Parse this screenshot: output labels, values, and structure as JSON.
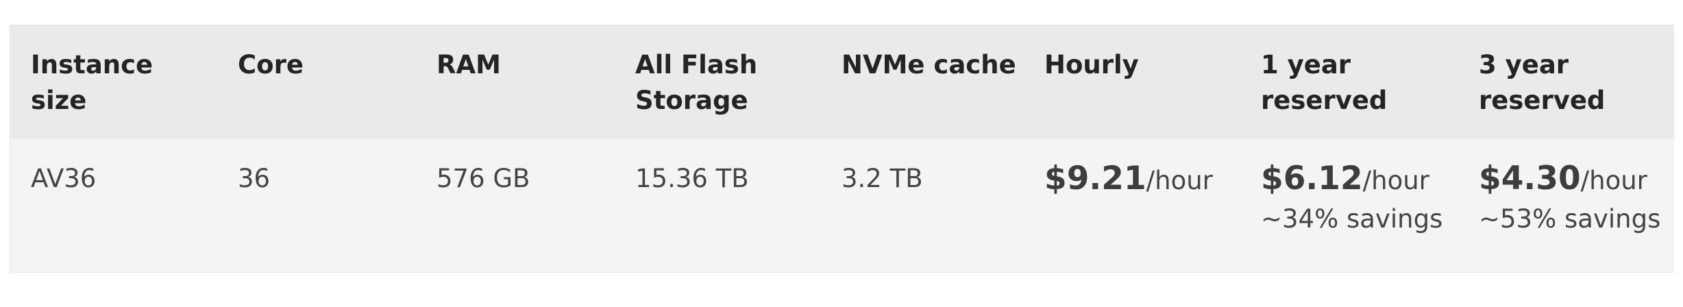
{
  "headers": [
    "Instance size",
    "Core",
    "RAM",
    "All Flash Storage",
    "NVMe cache",
    "Hourly",
    "1 year reserved",
    "3 year reserved"
  ],
  "row": {
    "instance_size": "AV36",
    "core": "36",
    "ram": "576 GB",
    "storage": "15.36 TB",
    "nvme_cache": "3.2 TB",
    "hourly": {
      "amount": "$9.21",
      "unit": "/hour"
    },
    "one_year": {
      "amount": "$6.12",
      "unit": "/hour",
      "savings": "~34% savings"
    },
    "three_year": {
      "amount": "$4.30",
      "unit": "/hour",
      "savings": "~53% savings"
    }
  }
}
